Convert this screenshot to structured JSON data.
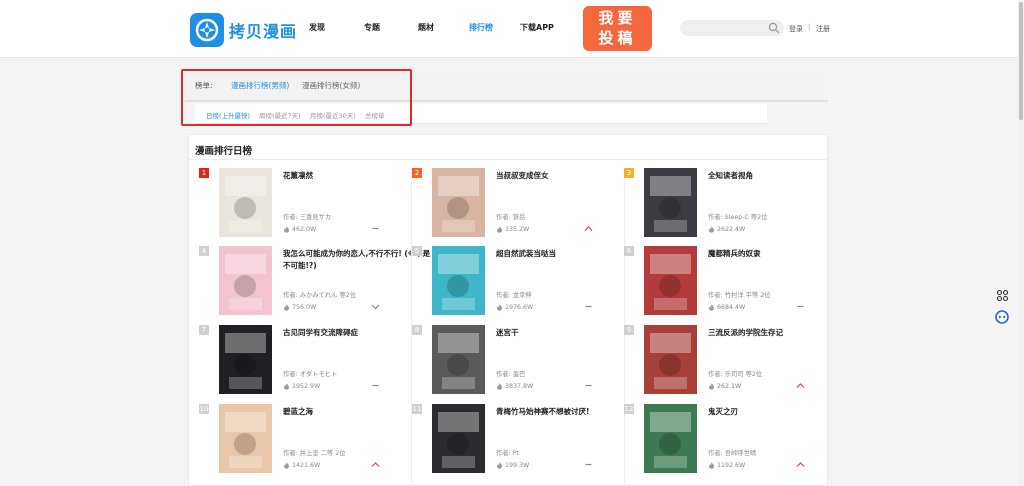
{
  "brand": {
    "name": "拷贝漫画",
    "color": "#1e8fe6"
  },
  "nav": [
    {
      "label": "发现",
      "active": false
    },
    {
      "label": "专题",
      "active": false
    },
    {
      "label": "题材",
      "active": false
    },
    {
      "label": "排行榜",
      "active": true
    },
    {
      "label": "下载APP",
      "active": false
    }
  ],
  "submit_button": "我要\n投稿",
  "search": {
    "placeholder": ""
  },
  "auth": {
    "login": "登录",
    "separator": "|",
    "register": "注册"
  },
  "ranking": {
    "label": "榜单:",
    "tabs": [
      {
        "label": "漫画排行榜(男频)",
        "active": true
      },
      {
        "label": "漫画排行榜(女频)",
        "active": false
      }
    ],
    "periods": [
      {
        "label": "日榜(上升最快)",
        "active": true
      },
      {
        "label": "周榜(最近7天)",
        "active": false
      },
      {
        "label": "月榜(最近30天)",
        "active": false
      },
      {
        "label": "总榜单",
        "active": false
      }
    ]
  },
  "daily": {
    "title": "漫画排行日榜",
    "items": [
      {
        "rank": "1",
        "title": "花薰凛然",
        "author": "作者:  三香見サカ",
        "heat": "462.0W",
        "trend": "flat",
        "cover_color": "#e9e4dc"
      },
      {
        "rank": "2",
        "title": "当叔叔变成侄女",
        "author": "作者:  铁岳",
        "heat": "135.2W",
        "trend": "up",
        "cover_color": "#d7b5a2"
      },
      {
        "rank": "3",
        "title": "全知读者视角",
        "author": "作者:  Sleep-C  等2位",
        "heat": "2622.4W",
        "trend": "none",
        "cover_color": "#3b3d42"
      },
      {
        "rank": "4",
        "title": "我怎么可能成为你的恋人,不行不行!  (※不是不可能!?)",
        "author": "作者:  みかみてれん  等2位",
        "heat": "756.0W",
        "trend": "down",
        "cover_color": "#f3c4cf"
      },
      {
        "rank": "5",
        "title": "超自然武装当哒当",
        "author": "作者:  龙幸伸",
        "heat": "1976.6W",
        "trend": "flat",
        "cover_color": "#3fb6c9"
      },
      {
        "rank": "6",
        "title": "魔都精兵的奴隶",
        "author": "作者:  竹村洋  平等  2位",
        "heat": "6684.4W",
        "trend": "flat",
        "cover_color": "#b43b3b"
      },
      {
        "rank": "7",
        "title": "古见同学有交流障碍症",
        "author": "作者:  オダトモヒト",
        "heat": "1952.9W",
        "trend": "flat",
        "cover_color": "#1f1f24"
      },
      {
        "rank": "8",
        "title": "迷宫干",
        "author": "作者:  蛋巴",
        "heat": "3837.8W",
        "trend": "flat",
        "cover_color": "#5a5a5a"
      },
      {
        "rank": "9",
        "title": "三流反派的学院生存记",
        "author": "作者:  乐司司  等2位",
        "heat": "262.1W",
        "trend": "up",
        "cover_color": "#a8403a"
      },
      {
        "rank": "10",
        "title": "碧蓝之海",
        "author": "作者:  井上坚  二等  2位",
        "heat": "1421.6W",
        "trend": "up",
        "cover_color": "#e8c7a8"
      },
      {
        "rank": "11",
        "title": "青梅竹马始神赛不想被讨厌!",
        "author": "作者:  Pt",
        "heat": "199.3W",
        "trend": "flat",
        "cover_color": "#2b2b30"
      },
      {
        "rank": "12",
        "title": "鬼灭之刃",
        "author": "作者:  吾峠呼世晴",
        "heat": "1192.6W",
        "trend": "up",
        "cover_color": "#3d7a54"
      }
    ]
  },
  "colors": {
    "red_frame": "#e02b2b",
    "up_trend": "#e8453c",
    "submit": "#f5683f"
  }
}
